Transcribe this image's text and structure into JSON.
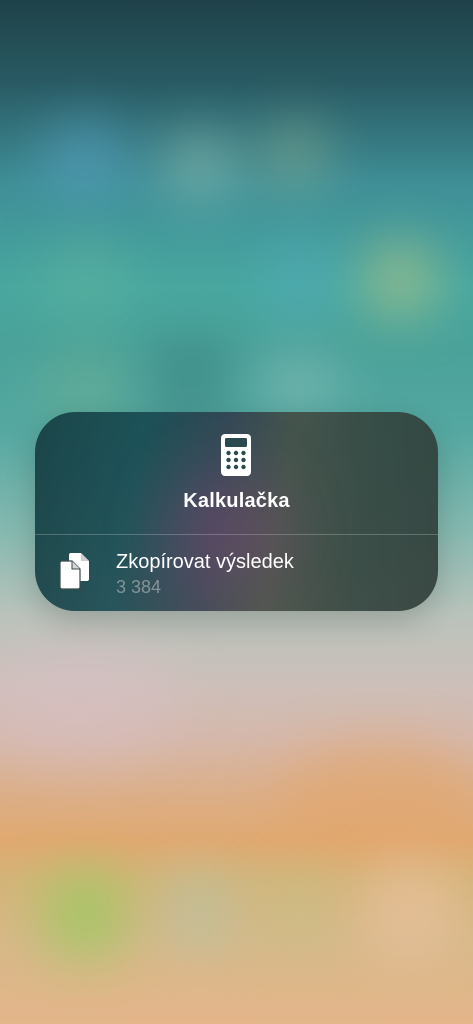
{
  "menu": {
    "app_title": "Kalkulačka",
    "app_icon": "calculator-icon",
    "actions": [
      {
        "label": "Zkopírovat výsledek",
        "value": "3 384",
        "icon": "copy-icon"
      }
    ]
  },
  "colors": {
    "wallpaper_top": "#1f4249",
    "wallpaper_mid": "#48a79f",
    "wallpaper_bottom": "#e0a971",
    "card_tint": "#163e42",
    "text_primary": "#ffffff",
    "text_secondary": "#8a8a8a"
  }
}
